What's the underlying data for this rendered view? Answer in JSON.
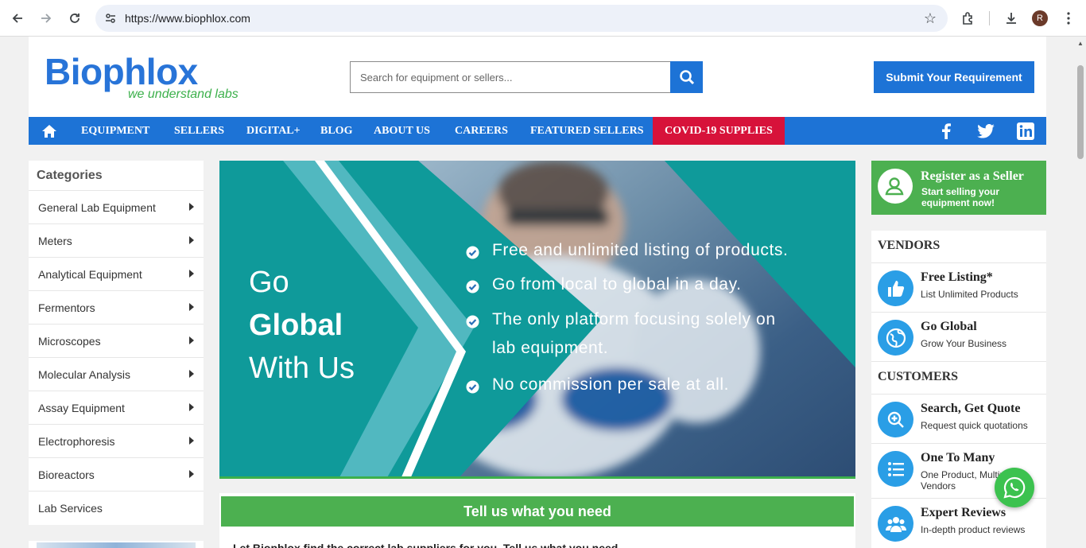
{
  "browser": {
    "url": "https://www.biophlox.com",
    "avatar_letter": "R"
  },
  "header": {
    "logo_text": "Biophlox",
    "logo_tagline": "we understand labs",
    "search_placeholder": "Search for equipment or sellers...",
    "submit_label": "Submit Your Requirement"
  },
  "nav": {
    "items": [
      "EQUIPMENT",
      "SELLERS",
      "DIGITAL+",
      "BLOG",
      "ABOUT US",
      "CAREERS",
      "FEATURED SELLERS"
    ],
    "covid": "COVID-19 SUPPLIES"
  },
  "categories": {
    "title": "Categories",
    "items": [
      "General Lab Equipment",
      "Meters",
      "Analytical Equipment",
      "Fermentors",
      "Microscopes",
      "Molecular Analysis",
      "Assay Equipment",
      "Electrophoresis",
      "Bioreactors",
      "Lab Services"
    ]
  },
  "banner": {
    "line1": "Go",
    "line2": "Global",
    "line3": "With Us",
    "bullets": [
      "Free and unlimited listing of products.",
      "Go from local to global in a day.",
      "The only platform focusing solely on",
      "No commission per sale at all."
    ],
    "bullet3_cont": "lab equipment."
  },
  "tellus": {
    "title": "Tell us what you need",
    "partial": "Let Biophlox find the correct lab suppliers for you. Tell us what you need"
  },
  "register": {
    "title": "Register as a Seller",
    "subtitle": "Start selling your equipment now!"
  },
  "right": {
    "vendors_title": "VENDORS",
    "customers_title": "CUSTOMERS",
    "vendors": [
      {
        "title": "Free Listing*",
        "sub": "List Unlimited Products"
      },
      {
        "title": "Go Global",
        "sub": "Grow Your Business"
      }
    ],
    "customers": [
      {
        "title": "Search, Get Quote",
        "sub": "Request quick quotations"
      },
      {
        "title": "One To Many",
        "sub": "One Product, Multiple Vendors"
      },
      {
        "title": "Expert Reviews",
        "sub": "In-depth product reviews"
      }
    ]
  },
  "colors": {
    "brand_blue": "#1d73d6",
    "brand_green": "#4cb050",
    "covid_red": "#d7123a",
    "banner_teal": "#0f9a9a"
  }
}
